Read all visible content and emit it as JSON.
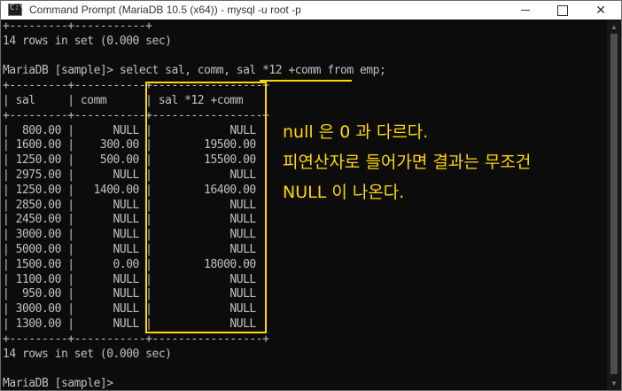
{
  "window": {
    "title": "Command Prompt (MariaDB 10.5 (x64)) - mysql  -u root -p",
    "icon_text": "C:\\",
    "buttons": {
      "minimize": "",
      "maximize": "",
      "close": "✕"
    }
  },
  "console": {
    "lines": [
      "+---------+-----------+",
      "14 rows in set (0.000 sec)",
      "",
      "MariaDB [sample]> select sal, comm, sal *12 +comm from emp;",
      "+---------+-----------+-----------------+",
      "| sal     | comm      | sal *12 +comm   |",
      "+---------+-----------+-----------------+",
      "|  800.00 |      NULL |            NULL |",
      "| 1600.00 |    300.00 |        19500.00 |",
      "| 1250.00 |    500.00 |        15500.00 |",
      "| 2975.00 |      NULL |            NULL |",
      "| 1250.00 |   1400.00 |        16400.00 |",
      "| 2850.00 |      NULL |            NULL |",
      "| 2450.00 |      NULL |            NULL |",
      "| 3000.00 |      NULL |            NULL |",
      "| 5000.00 |      NULL |            NULL |",
      "| 1500.00 |      0.00 |        18000.00 |",
      "| 1100.00 |      NULL |            NULL |",
      "|  950.00 |      NULL |            NULL |",
      "| 3000.00 |      NULL |            NULL |",
      "| 1300.00 |      NULL |            NULL |",
      "+---------+-----------+-----------------+",
      "14 rows in set (0.000 sec)",
      "",
      "MariaDB [sample]>"
    ]
  },
  "annotation": {
    "lines": [
      "null 은 0 과 다르다.",
      "피연산자로 들어가면 결과는 무조건",
      "NULL 이 나온다."
    ],
    "color": "#ffd700"
  },
  "scrollbar": {
    "up_arrow": "▲",
    "down_arrow": "▼"
  }
}
